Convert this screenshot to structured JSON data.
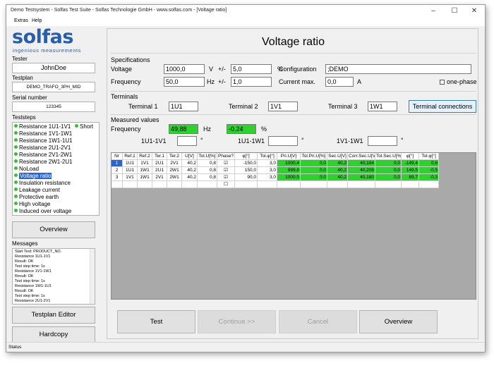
{
  "window": {
    "title": "Demo Testsystem - Solfas Test Suite - Solfas Technologie GmbH - www.solfas.com - [Voltage ratio]",
    "controls": [
      "–",
      "☐",
      "✕"
    ]
  },
  "menu": [
    "Extras",
    "Help"
  ],
  "logo": {
    "word": "solfas",
    "tagline": "ingenious measurements"
  },
  "sidebar": {
    "tester_label": "Tester",
    "tester_value": "JohnDoe",
    "testplan_label": "Testplan",
    "testplan_value": "DEMO_TRAFO_3PH_MID",
    "serial_label": "Serial number",
    "serial_value": "123345",
    "teststeps_label": "Teststeps",
    "teststeps": [
      {
        "label": "Resistance 1U1-1V1",
        "dot": true
      },
      {
        "label": "Resistance 1V1-1W1",
        "dot": true
      },
      {
        "label": "Resistance 1W1-1U1",
        "dot": true
      },
      {
        "label": "Resistance 2U1-2V1",
        "dot": true
      },
      {
        "label": "Resistance 2V1-2W1",
        "dot": true
      },
      {
        "label": "Resistance 2W1-2U1",
        "dot": true
      },
      {
        "label": "NoLoad",
        "dot": true
      },
      {
        "label": "Voltage ratio",
        "dot": true,
        "selected": true
      },
      {
        "label": "Insulation resistance",
        "dot": true
      },
      {
        "label": "Leakage current",
        "dot": true
      },
      {
        "label": "Protective earth",
        "dot": true
      },
      {
        "label": "High voltage",
        "dot": true
      },
      {
        "label": "Induced over voltage",
        "dot": true
      }
    ],
    "short_label": "Short",
    "overview_button": "Overview",
    "messages_label": "Messages",
    "messages": [
      "Start Test: PRODUCT_NO.",
      "Resistance 1U1-1V1",
      "Result: OK",
      "Test step time: 1s",
      "Resistance 1V1-1W1",
      "Result: OK",
      "Test step time: 1s",
      "Resistance 1W1-1U1",
      "Result: OK",
      "Test step time: 1s",
      "Resistance 2U1-2V1"
    ],
    "testplan_editor_button": "Testplan Editor",
    "hardcopy_button": "Hardcopy"
  },
  "status": "Status",
  "main": {
    "title": "Voltage ratio",
    "specifications": {
      "heading": "Specifications",
      "voltage_label": "Voltage",
      "voltage_value": "1000,0",
      "voltage_unit": "V",
      "voltage_tol_label": "+/-",
      "voltage_tol_value": "5,0",
      "voltage_tol_unit": "%",
      "frequency_label": "Frequency",
      "frequency_value": "50,0",
      "frequency_unit": "Hz",
      "frequency_tol_label": "+/-",
      "frequency_tol_value": "1,0",
      "frequency_tol_unit": "%",
      "configuration_label": "Configuration",
      "configuration_value": ";DEMO",
      "current_max_label": "Current max.",
      "current_max_value": "0,0",
      "current_max_unit": "A",
      "one_phase_label": "one-phase"
    },
    "terminals": {
      "heading": "Terminals",
      "t1_label": "Terminal 1",
      "t1_value": "1U1",
      "t2_label": "Terminal 2",
      "t2_value": "1V1",
      "t3_label": "Terminal 3",
      "t3_value": "1W1",
      "connections_button": "Terminal connections"
    },
    "measured": {
      "heading": "Measured values",
      "frequency_label": "Frequency",
      "frequency_value": "49,88",
      "frequency_unit": "Hz",
      "deviation_value": "-0,24",
      "deviation_unit": "%",
      "angle1_label": "1U1-1V1",
      "angle2_label": "1U1-1W1",
      "angle3_label": "1V1-1W1",
      "degree": "°"
    },
    "table": {
      "headers": [
        "Nr",
        "Ref.1",
        "Ref.2",
        "Ter.1",
        "Ter.2",
        "U[V]",
        "Tol.U[%]",
        "Phase?",
        "φ[°]",
        "Tol.φ[°]",
        "Pri.U[V]",
        "Tol.Pri.U[%]",
        "Sec.U[V]",
        "Corr.Sec.U[V]",
        "Tol.Sec.U[%]",
        "φ[°]",
        "Tol.φ[°]"
      ],
      "rows": [
        [
          "1",
          "1U1",
          "1V1",
          "2U1",
          "2V1",
          "40,2",
          "0,8",
          "☑",
          "-150,0",
          "3,0",
          "1000,4",
          "0,0",
          "40,2",
          "40,184",
          "0,0",
          "-149,4",
          "0,6"
        ],
        [
          "2",
          "1U1",
          "1W1",
          "2U1",
          "2W1",
          "40,2",
          "0,8",
          "☑",
          "150,0",
          "3,0",
          "999,8",
          "0,0",
          "40,2",
          "40,208",
          "0,0",
          "149,5",
          "-0,5"
        ],
        [
          "3",
          "1V1",
          "1W1",
          "2V1",
          "2W1",
          "40,2",
          "0,8",
          "☑",
          "90,0",
          "3,0",
          "1000,5",
          "0,0",
          "40,2",
          "40,180",
          "0,0",
          "89,7",
          "-0,3"
        ],
        [
          "",
          "",
          "",
          "",
          "",
          "",
          "",
          "☐",
          "",
          "",
          "",
          "",
          "",
          "",
          "",
          "",
          ""
        ]
      ]
    },
    "buttons": {
      "test": "Test",
      "continue": "Continue >>",
      "cancel": "Cancel",
      "overview": "Overview"
    }
  },
  "colors": {
    "brand_blue": "#2a5ea9",
    "ok_green": "#2ed12e",
    "selection_blue": "#2a66d0"
  }
}
